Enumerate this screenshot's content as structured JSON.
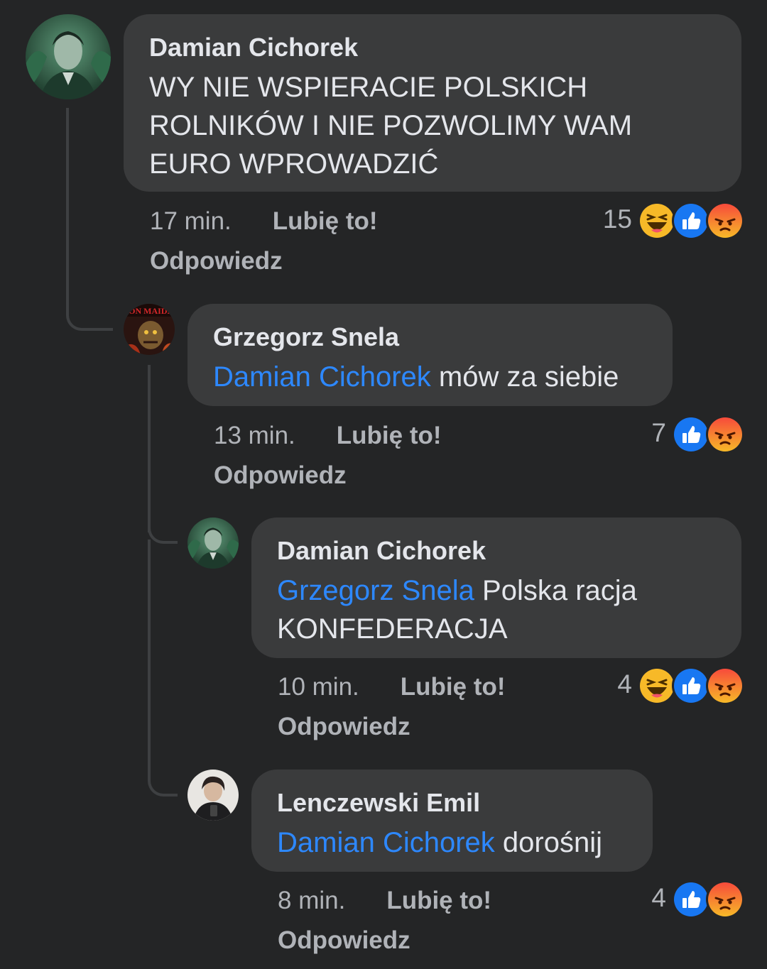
{
  "comments": [
    {
      "author": "Damian Cichorek",
      "mention": "",
      "text": "WY NIE WSPIERACIE POLSKICH ROLNIKÓW I NIE POZWOLIMY WAM EURO WPROWADZIĆ",
      "time": "17 min.",
      "like_label": "Lubię to!",
      "reply_label": "Odpowiedz",
      "reaction_count": "15",
      "reactions": [
        "laugh-icon",
        "like-icon",
        "angry-icon"
      ]
    },
    {
      "author": "Grzegorz Snela",
      "mention": "Damian Cichorek",
      "text": "mów za siebie",
      "time": "13 min.",
      "like_label": "Lubię to!",
      "reply_label": "Odpowiedz",
      "reaction_count": "7",
      "reactions": [
        "like-icon",
        "angry-icon"
      ]
    },
    {
      "author": "Damian Cichorek",
      "mention": "Grzegorz Snela",
      "text": "Polska racja KONFEDERACJA",
      "time": "10 min.",
      "like_label": "Lubię to!",
      "reply_label": "Odpowiedz",
      "reaction_count": "4",
      "reactions": [
        "laugh-icon",
        "like-icon",
        "angry-icon"
      ]
    },
    {
      "author": "Lenczewski Emil",
      "mention": "Damian Cichorek",
      "text": "dorośnij",
      "time": "8 min.",
      "like_label": "Lubię to!",
      "reply_label": "Odpowiedz",
      "reaction_count": "4",
      "reactions": [
        "like-icon",
        "angry-icon"
      ]
    }
  ],
  "colors": {
    "background": "#242526",
    "bubble": "#3a3b3c",
    "mention": "#2d88ff",
    "secondary_text": "#b0b3b8",
    "like_blue": "#1877f2",
    "angry_orange": "#f7714c",
    "laugh_yellow": "#f7b928"
  }
}
